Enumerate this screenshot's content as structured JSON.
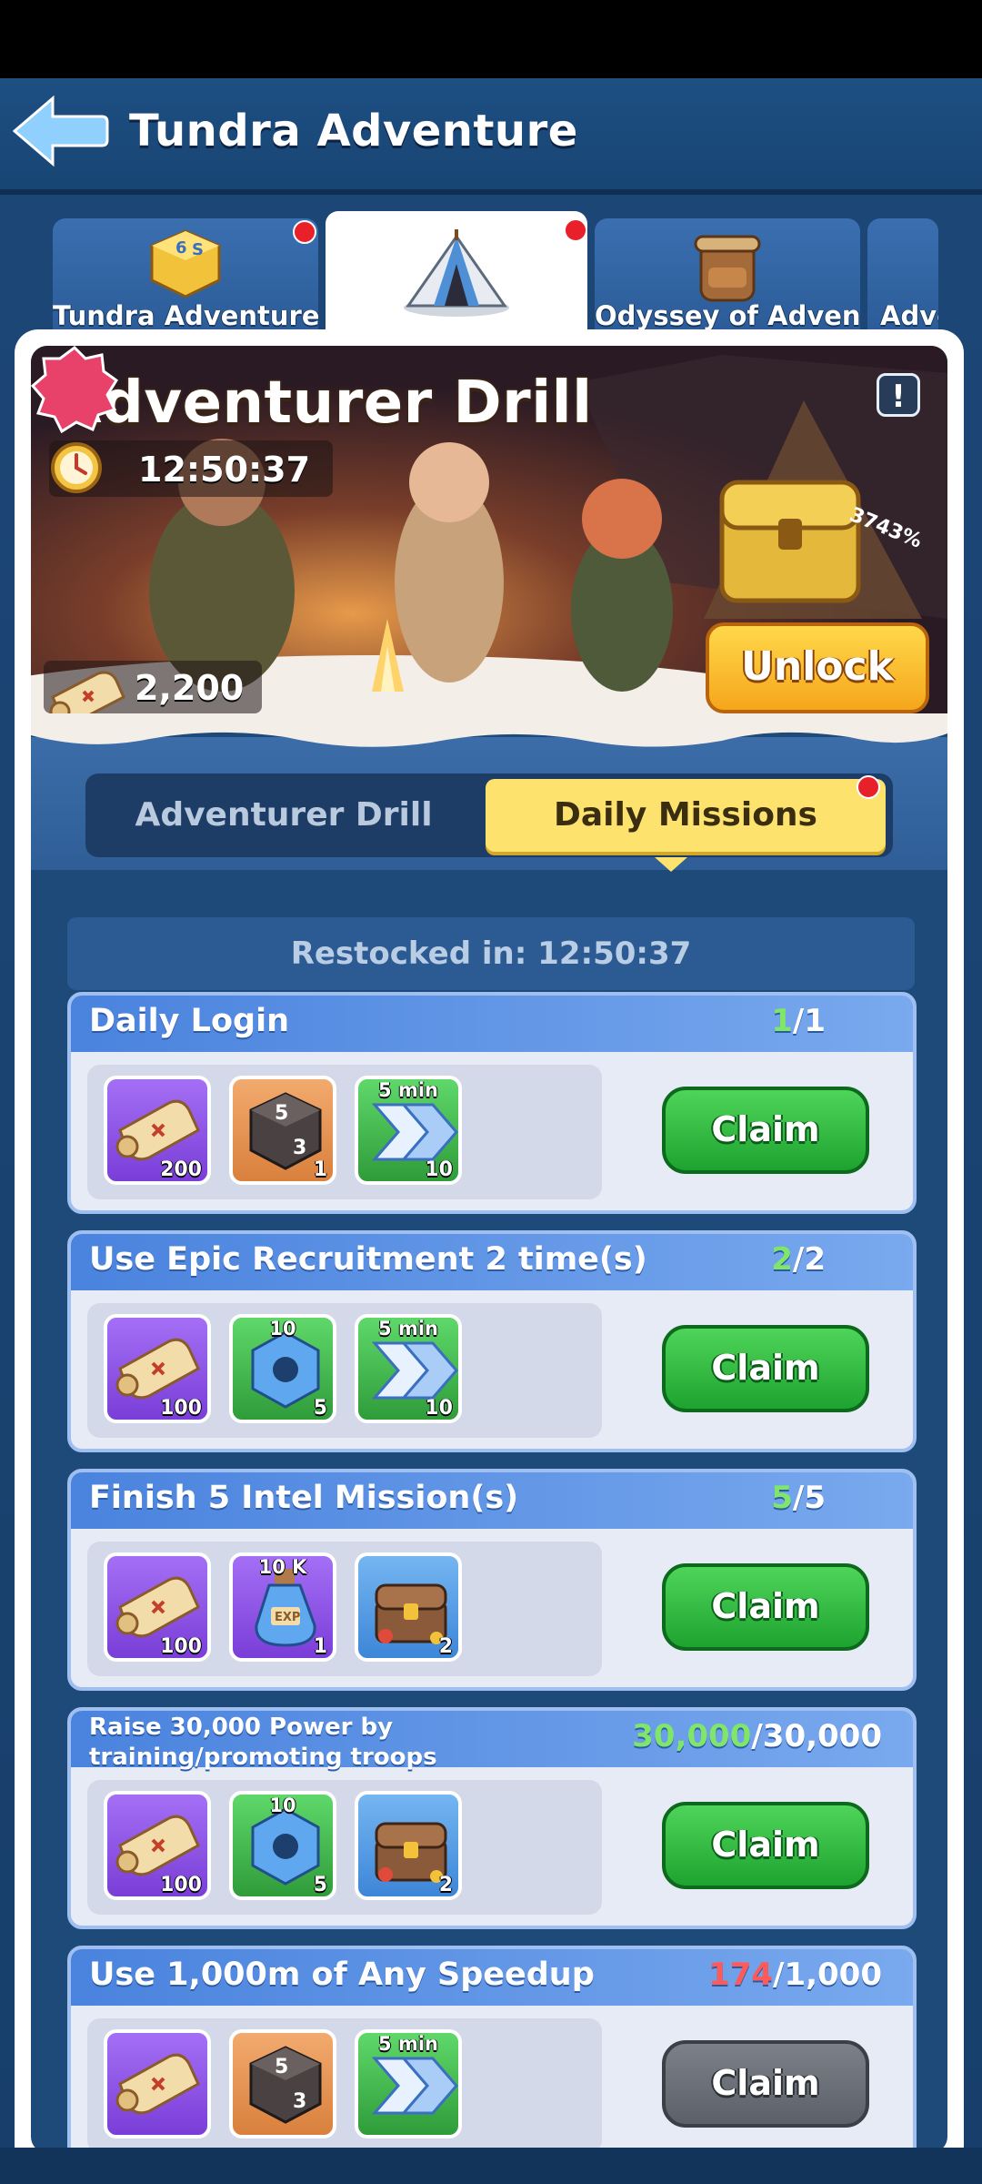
{
  "header": {
    "title": "Tundra Adventure"
  },
  "tabs": [
    {
      "label": "Tundra Adventure",
      "badge": true
    },
    {
      "label": "",
      "badge": true,
      "active": true
    },
    {
      "label": "Odyssey of Adventure",
      "badge": false
    },
    {
      "label": "Adve",
      "badge": false
    }
  ],
  "banner": {
    "title": "Adventurer Drill",
    "timer": "12:50:37",
    "scroll_count": "2,200",
    "unlock_label": "Unlock",
    "bonus_badge": "3743%",
    "info_icon": "exclamation-icon"
  },
  "subtabs": {
    "drill": "Adventurer Drill",
    "missions": "Daily Missions"
  },
  "restock": "Restocked in: 12:50:37",
  "missions": [
    {
      "title": "Daily Login",
      "progress_current": "1",
      "progress_total": "/1",
      "rewards": [
        {
          "icon": "scroll-icon",
          "color": "purple",
          "count": "200"
        },
        {
          "icon": "dice-icon",
          "color": "orange",
          "count": "1"
        },
        {
          "icon": "speedup-icon",
          "color": "green",
          "count": "10",
          "top": "5 min"
        }
      ],
      "claim": "Claim"
    },
    {
      "title": "Use Epic Recruitment 2 time(s)",
      "progress_current": "2",
      "progress_total": "/2",
      "rewards": [
        {
          "icon": "scroll-icon",
          "color": "purple",
          "count": "100"
        },
        {
          "icon": "gear-icon",
          "color": "green",
          "count": "5",
          "top": "10"
        },
        {
          "icon": "speedup-icon",
          "color": "green",
          "count": "10",
          "top": "5 min"
        }
      ],
      "claim": "Claim"
    },
    {
      "title": "Finish 5 Intel Mission(s)",
      "progress_current": "5",
      "progress_total": "/5",
      "rewards": [
        {
          "icon": "scroll-icon",
          "color": "purple",
          "count": "100"
        },
        {
          "icon": "exp-potion-icon",
          "color": "purple",
          "count": "1",
          "top": "10 K"
        },
        {
          "icon": "chest-icon",
          "color": "blue",
          "count": "2"
        }
      ],
      "claim": "Claim"
    },
    {
      "title": "Raise 30,000 Power by training/promoting troops",
      "progress_current": "30,000",
      "progress_total": "/30,000",
      "rewards": [
        {
          "icon": "scroll-icon",
          "color": "purple",
          "count": "100"
        },
        {
          "icon": "gear-icon",
          "color": "green",
          "count": "5",
          "top": "10"
        },
        {
          "icon": "chest-icon",
          "color": "blue",
          "count": "2"
        }
      ],
      "claim": "Claim"
    },
    {
      "title": "Use 1,000m of Any Speedup",
      "progress_current": "174",
      "progress_total": "/1,000",
      "rewards": [
        {
          "icon": "scroll-icon",
          "color": "purple",
          "count": ""
        },
        {
          "icon": "dice-icon",
          "color": "orange",
          "count": ""
        },
        {
          "icon": "speedup-icon",
          "color": "green",
          "count": "",
          "top": "5 min"
        }
      ],
      "claim": "Claim"
    }
  ]
}
